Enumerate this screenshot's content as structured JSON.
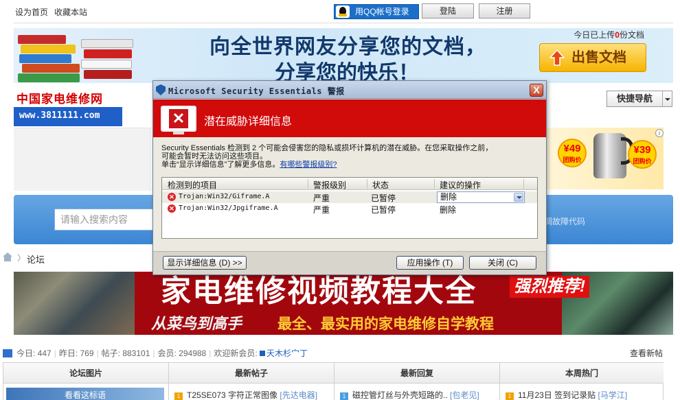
{
  "top_links": [
    "设为首页",
    "收藏本站"
  ],
  "top_buttons": {
    "qq_login": "用QQ帐号登录",
    "login": "登陆",
    "register": "注册"
  },
  "banner": {
    "line1": "向全世界网友分享您的文档，",
    "line2": "分享您的快乐！",
    "upload_prefix": "今日已上传",
    "upload_count": "0",
    "upload_suffix": "份文档",
    "sell_button": "出售文档"
  },
  "logo": {
    "title": "中国家电维修网",
    "url": "www.3811111.com"
  },
  "quick_nav": "快捷导航",
  "product_ad": {
    "price1": "¥49",
    "price1_tag": "团购价",
    "price2": "¥39",
    "price2_tag": "团购价",
    "info": "i"
  },
  "search": {
    "placeholder": "请输入搜索内容",
    "hint": "调故障代码"
  },
  "breadcrumb": {
    "current": "论坛",
    "separator": "〉"
  },
  "video_banner": {
    "title": "家电维修视频教程大全",
    "tag": "强烈推荐!",
    "sub1": "从菜鸟到高手",
    "sub2": "最全、最实用的家电维修自学教程"
  },
  "stats": {
    "today_label": "今日: 447",
    "yesterday_label": "昨日: 769",
    "posts_label": "帖子: 883101",
    "members_label": "会员: 294988",
    "welcome_label": "欢迎新会员:",
    "new_member": "天木杉宀丁",
    "view_new": "查看新帖"
  },
  "forum_table": {
    "headers": [
      "论坛图片",
      "最新帖子",
      "最新回复",
      "本周热门"
    ],
    "pic_caption": "看看这标语",
    "latest_post": {
      "badge": "1",
      "title": "T25SE073 字符正常图像",
      "author": "[先达电器]"
    },
    "latest_reply": {
      "badge": "1",
      "title": "磁控管灯丝与外壳短路的..",
      "author": "[包老见]"
    },
    "hot": {
      "badge": "1",
      "title": "11月23日 签到记录贴",
      "author": "[马学江]"
    }
  },
  "dialog": {
    "title": "Microsoft Security Essentials 警报",
    "close": "X",
    "header": "潜在威胁详细信息",
    "desc_line1": "Security Essentials 检测到 2 个可能会侵害您的隐私或损坏计算机的潜在威胁。在您采取操作之前，",
    "desc_line2": "可能会暂时无法访问这些项目。",
    "desc_line3": "单击“显示详细信息”了解更多信息。",
    "desc_link": "有哪些警报级别?",
    "columns": [
      "检测到的项目",
      "警报级别",
      "状态",
      "建议的操作"
    ],
    "rows": [
      {
        "name": "Trojan:Win32/Giframe.A",
        "level": "严重",
        "status": "已暂停",
        "action": "删除"
      },
      {
        "name": "Trojan:Win32/Jpgiframe.A",
        "level": "严重",
        "status": "已暂停",
        "action": "删除"
      }
    ],
    "show_details": "显示详细信息 (D) >>",
    "apply": "应用操作 (T)",
    "close_button": "关闭 (C)"
  },
  "colors": {
    "threat_red": "#d10a0a",
    "link_blue": "#1d5fbf",
    "banner_red": "#a3070e",
    "search_blue": "#3b86d3"
  }
}
